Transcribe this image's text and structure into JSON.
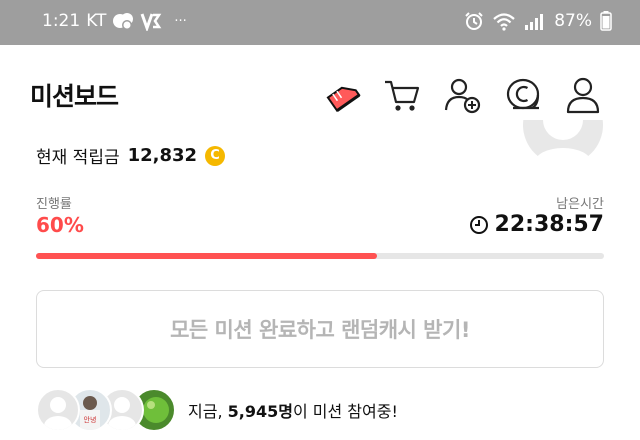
{
  "status_bar": {
    "time": "1:21",
    "carrier": "KT",
    "extra": "···",
    "battery": "87%"
  },
  "header": {
    "title": "미션보드"
  },
  "icons": [
    "shoe-icon",
    "cart-icon",
    "add-user-icon",
    "coin-icon",
    "profile-icon"
  ],
  "balance": {
    "label": "현재 적립금",
    "amount": "12,832",
    "coin_symbol": "C"
  },
  "progress": {
    "label": "진행률",
    "value_text": "60%",
    "fraction": 0.6
  },
  "remaining": {
    "label": "남은시간",
    "time": "22:38:57"
  },
  "cta": {
    "label": "모든 미션 완료하고 랜덤캐시 받기!"
  },
  "participants": {
    "prefix": "지금, ",
    "count": "5,945명",
    "suffix": "이 미션 참여중!",
    "avatar_text": "안녕"
  },
  "colors": {
    "accent": "#ff5252",
    "coin": "#f5b800",
    "status_bar": "#9e9e9e"
  }
}
